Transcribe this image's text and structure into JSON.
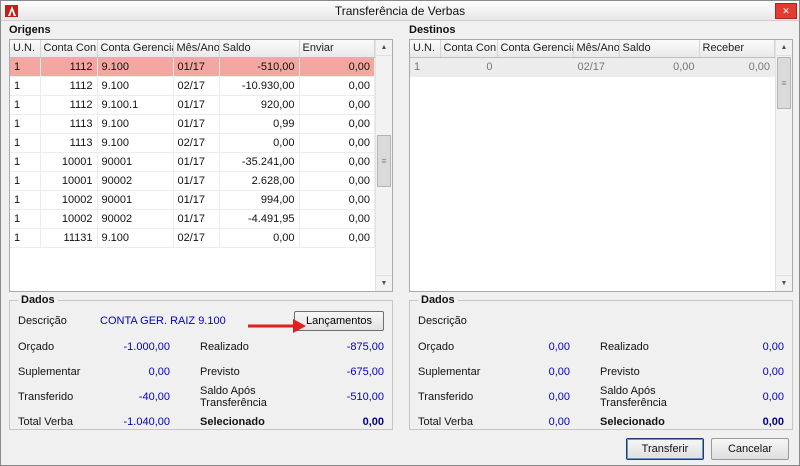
{
  "window": {
    "title": "Transferência de Verbas"
  },
  "icons": {
    "close": "✕",
    "up": "▲",
    "down": "▼",
    "grip": "≡"
  },
  "colors": {
    "selected_row": "#f4a7a0",
    "number_blue": "#0000cc",
    "annotation_red": "#e0201c"
  },
  "origens": {
    "title": "Origens",
    "columns": [
      "U.N.",
      "Conta Con...",
      "Conta Gerencial",
      "Mês/Ano",
      "Saldo",
      "Enviar"
    ],
    "rows": [
      {
        "un": "1",
        "conta": "1112",
        "gerencial": "9.100",
        "mes": "01/17",
        "saldo": "-510,00",
        "enviar": "0,00",
        "state": "selected"
      },
      {
        "un": "1",
        "conta": "1112",
        "gerencial": "9.100",
        "mes": "02/17",
        "saldo": "-10.930,00",
        "enviar": "0,00"
      },
      {
        "un": "1",
        "conta": "1112",
        "gerencial": "9.100.1",
        "mes": "01/17",
        "saldo": "920,00",
        "enviar": "0,00"
      },
      {
        "un": "1",
        "conta": "1113",
        "gerencial": "9.100",
        "mes": "01/17",
        "saldo": "0,99",
        "enviar": "0,00"
      },
      {
        "un": "1",
        "conta": "1113",
        "gerencial": "9.100",
        "mes": "02/17",
        "saldo": "0,00",
        "enviar": "0,00"
      },
      {
        "un": "1",
        "conta": "10001",
        "gerencial": "90001",
        "mes": "01/17",
        "saldo": "-35.241,00",
        "enviar": "0,00"
      },
      {
        "un": "1",
        "conta": "10001",
        "gerencial": "90002",
        "mes": "01/17",
        "saldo": "2.628,00",
        "enviar": "0,00"
      },
      {
        "un": "1",
        "conta": "10002",
        "gerencial": "90001",
        "mes": "01/17",
        "saldo": "994,00",
        "enviar": "0,00"
      },
      {
        "un": "1",
        "conta": "10002",
        "gerencial": "90002",
        "mes": "01/17",
        "saldo": "-4.491,95",
        "enviar": "0,00"
      },
      {
        "un": "1",
        "conta": "11131",
        "gerencial": "9.100",
        "mes": "02/17",
        "saldo": "0,00",
        "enviar": "0,00"
      }
    ],
    "dados": {
      "title": "Dados",
      "descricao_label": "Descrição",
      "descricao_value": "CONTA GER. RAIZ 9.100",
      "lancamentos_label": "Lançamentos",
      "rows": [
        {
          "l1": "Orçado",
          "v1": "-1.000,00",
          "l2": "Realizado",
          "v2": "-875,00"
        },
        {
          "l1": "Suplementar",
          "v1": "0,00",
          "l2": "Previsto",
          "v2": "-675,00"
        },
        {
          "l1": "Transferido",
          "v1": "-40,00",
          "l2": "Saldo Após Transferência",
          "v2": "-510,00"
        },
        {
          "l1": "Total Verba",
          "v1": "-1.040,00",
          "l2": "Selecionado",
          "v2": "0,00"
        }
      ]
    }
  },
  "destinos": {
    "title": "Destinos",
    "columns": [
      "U.N.",
      "Conta Con...",
      "Conta Gerencial",
      "Mês/Ano",
      "Saldo",
      "Receber"
    ],
    "rows": [
      {
        "un": "1",
        "conta": "0",
        "gerencial": "",
        "mes": "02/17",
        "saldo": "0,00",
        "receber": "0,00",
        "state": "inactive"
      }
    ],
    "dados": {
      "title": "Dados",
      "descricao_label": "Descrição",
      "descricao_value": "",
      "rows": [
        {
          "l1": "Orçado",
          "v1": "0,00",
          "l2": "Realizado",
          "v2": "0,00"
        },
        {
          "l1": "Suplementar",
          "v1": "0,00",
          "l2": "Previsto",
          "v2": "0,00"
        },
        {
          "l1": "Transferido",
          "v1": "0,00",
          "l2": "Saldo Após Transferência",
          "v2": "0,00"
        },
        {
          "l1": "Total Verba",
          "v1": "0,00",
          "l2": "Selecionado",
          "v2": "0,00"
        }
      ]
    }
  },
  "footer": {
    "transferir": "Transferir",
    "cancelar": "Cancelar"
  }
}
